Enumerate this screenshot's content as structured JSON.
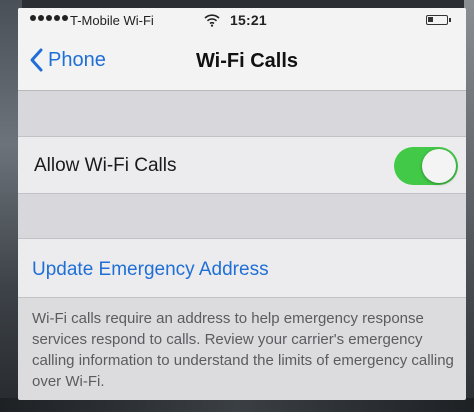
{
  "status_bar": {
    "carrier": "T-Mobile Wi-Fi",
    "time": "15:21",
    "wifi_icon": "wifi-icon",
    "battery_icon": "battery-icon"
  },
  "nav": {
    "back_label": "Phone",
    "title": "Wi-Fi Calls"
  },
  "settings": {
    "allow_wifi_calls_label": "Allow Wi-Fi Calls",
    "allow_wifi_calls_enabled": true,
    "update_address_label": "Update Emergency Address"
  },
  "footer": {
    "text": "Wi-Fi calls require an address to help emergency response services respond to calls. Review your carrier's emergency calling information to understand the limits of emergency calling over Wi-Fi."
  },
  "colors": {
    "accent": "#1f6fd6",
    "toggle_on": "#43c948"
  }
}
